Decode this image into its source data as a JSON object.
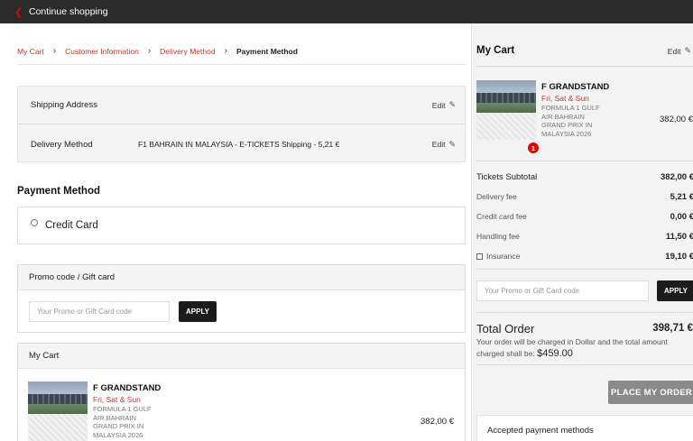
{
  "topbar": {
    "back_icon": "chevron-left-icon",
    "continue_label": "Continue shopping"
  },
  "breadcrumb": [
    {
      "label": "My Cart"
    },
    {
      "label": "Customer Information"
    },
    {
      "label": "Delivery Method"
    },
    {
      "label": "Payment Method"
    }
  ],
  "summary": {
    "shipping_label": "Shipping Address",
    "delivery_label": "Delivery Method",
    "delivery_value": "F1 BAHRAIN IN MALAYSIA - E-TICKETS Shipping - 5,21 €",
    "edit_label": "Edit"
  },
  "payment": {
    "title": "Payment Method",
    "option_label": "Credit Card"
  },
  "promo": {
    "title": "Promo code / Gift card",
    "placeholder": "Your Promo or Gift Card code",
    "apply_label": "APPLY"
  },
  "cart": {
    "title": "My Cart",
    "edit_label": "Edit",
    "item": {
      "name": "F GRANDSTAND",
      "days": "Fri, Sat & Sun",
      "desc_lines": [
        "FORMULA 1 GULF",
        "AIR BAHRAIN",
        "GRAND PRIX IN",
        "MALAYSIA 2026"
      ],
      "price": "382,00 €",
      "quantity": "1"
    }
  },
  "fees": {
    "subtotal_label": "Tickets Subtotal",
    "subtotal_value": "382,00 €",
    "delivery_label": "Delivery fee",
    "delivery_value": "5,21 €",
    "cc_label": "Credit card fee",
    "cc_value": "0,00 €",
    "handling_label": "Handling fee",
    "handling_value": "11,50 €",
    "insurance_label": "Insurance",
    "insurance_value": "19,10 €"
  },
  "total": {
    "label": "Total Order",
    "value": "398,71 €",
    "note": "Your order will be charged in Dollar and the total amount charged shall be:",
    "charged_amount": "$459.00"
  },
  "place_order_label": "PLACE MY ORDER",
  "accepted_payments_label": "Accepted payment methods",
  "colors": {
    "accent": "#e10600",
    "topbar": "#2b2b2b",
    "link": "#c0392b"
  }
}
